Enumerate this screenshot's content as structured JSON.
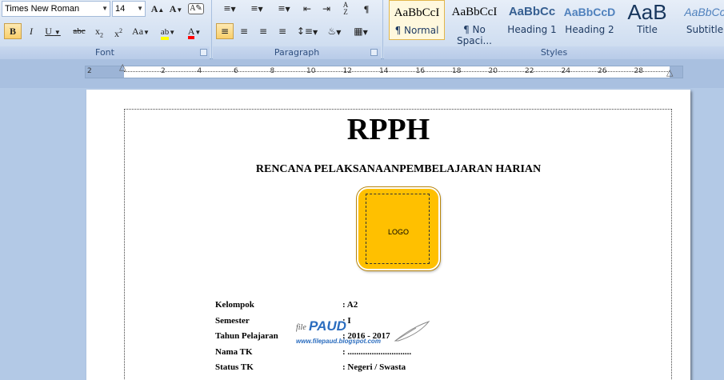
{
  "ribbon": {
    "font": {
      "family": "Times New Roman",
      "size": "14",
      "group_label": "Font"
    },
    "paragraph": {
      "group_label": "Paragraph"
    },
    "styles": {
      "group_label": "Styles",
      "items": [
        {
          "sample": "AaBbCcI",
          "name": "¶ Normal",
          "selected": true
        },
        {
          "sample": "AaBbCcI",
          "name": "¶ No Spaci..."
        },
        {
          "sample": "AaBbCc",
          "name": "Heading 1"
        },
        {
          "sample": "AaBbCcD",
          "name": "Heading 2"
        },
        {
          "sample": "AaB",
          "name": "Title"
        },
        {
          "sample": "AaBbCc",
          "name": "Subtitle"
        }
      ]
    },
    "accent_colors": {
      "highlight": "#ffff00",
      "font_color": "#ff0000"
    }
  },
  "ruler": {
    "ticks": [
      "2",
      "2",
      "4",
      "6",
      "8",
      "10",
      "12",
      "14",
      "16",
      "18",
      "20",
      "22",
      "24",
      "26",
      "28"
    ]
  },
  "document": {
    "title": "RPPH",
    "subtitle": "RENCANA PELAKSANAANPEMBELAJARAN HARIAN",
    "logo_text": "LOGO",
    "logo_color": "#ffc000",
    "info": [
      {
        "label": "Kelompok",
        "value": ": A2"
      },
      {
        "label": "Semester",
        "value": ": I"
      },
      {
        "label": "Tahun Pelajaran",
        "value": ": 2016 - 2017"
      },
      {
        "label": "Nama TK",
        "value": ": ............................."
      },
      {
        "label": "Status TK",
        "value": ": Negeri / Swasta"
      }
    ],
    "watermark": {
      "file": "file",
      "paud": "PAUD",
      "url": "www.filepaud.blogspot.com"
    }
  }
}
